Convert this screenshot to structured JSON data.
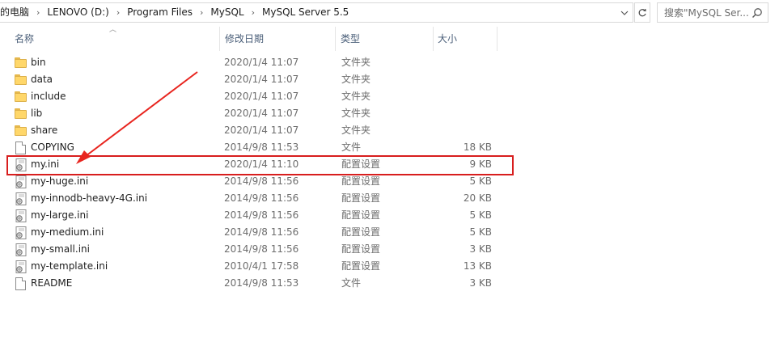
{
  "address": {
    "crumbs": [
      "的电脑",
      "LENOVO (D:)",
      "Program Files",
      "MySQL",
      "MySQL Server 5.5"
    ]
  },
  "search": {
    "placeholder": "搜索\"MySQL Ser..."
  },
  "columns": {
    "name": "名称",
    "date": "修改日期",
    "type": "类型",
    "size": "大小"
  },
  "files": [
    {
      "kind": "folder",
      "name": "bin",
      "date": "2020/1/4 11:07",
      "type": "文件夹",
      "size": ""
    },
    {
      "kind": "folder",
      "name": "data",
      "date": "2020/1/4 11:07",
      "type": "文件夹",
      "size": ""
    },
    {
      "kind": "folder",
      "name": "include",
      "date": "2020/1/4 11:07",
      "type": "文件夹",
      "size": ""
    },
    {
      "kind": "folder",
      "name": "lib",
      "date": "2020/1/4 11:07",
      "type": "文件夹",
      "size": ""
    },
    {
      "kind": "folder",
      "name": "share",
      "date": "2020/1/4 11:07",
      "type": "文件夹",
      "size": ""
    },
    {
      "kind": "file",
      "name": "COPYING",
      "date": "2014/9/8 11:53",
      "type": "文件",
      "size": "18 KB"
    },
    {
      "kind": "ini",
      "name": "my.ini",
      "date": "2020/1/4 11:10",
      "type": "配置设置",
      "size": "9 KB"
    },
    {
      "kind": "ini",
      "name": "my-huge.ini",
      "date": "2014/9/8 11:56",
      "type": "配置设置",
      "size": "5 KB"
    },
    {
      "kind": "ini",
      "name": "my-innodb-heavy-4G.ini",
      "date": "2014/9/8 11:56",
      "type": "配置设置",
      "size": "20 KB"
    },
    {
      "kind": "ini",
      "name": "my-large.ini",
      "date": "2014/9/8 11:56",
      "type": "配置设置",
      "size": "5 KB"
    },
    {
      "kind": "ini",
      "name": "my-medium.ini",
      "date": "2014/9/8 11:56",
      "type": "配置设置",
      "size": "5 KB"
    },
    {
      "kind": "ini",
      "name": "my-small.ini",
      "date": "2014/9/8 11:56",
      "type": "配置设置",
      "size": "3 KB"
    },
    {
      "kind": "ini",
      "name": "my-template.ini",
      "date": "2010/4/1 17:58",
      "type": "配置设置",
      "size": "13 KB"
    },
    {
      "kind": "file",
      "name": "README",
      "date": "2014/9/8 11:53",
      "type": "文件",
      "size": "3 KB"
    }
  ],
  "annotation": {
    "highlight_color": "#d81e1e",
    "highlighted_file": "my.ini"
  }
}
